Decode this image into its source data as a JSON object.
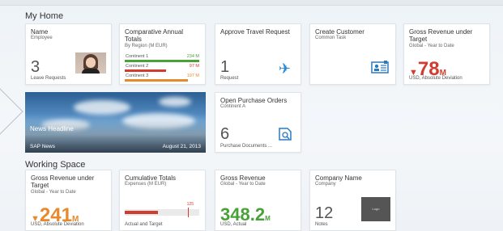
{
  "home": {
    "title": "My Home",
    "tiles": {
      "name": {
        "title": "Name",
        "subtitle": "Employee",
        "number": "3",
        "footer": "Leave Requests"
      },
      "comparative": {
        "title": "Comparative Annual Totals",
        "subtitle": "By Region (M EUR)",
        "rows": [
          {
            "label": "Continent 1",
            "value": "234 M",
            "color": "#4aa13a",
            "fill": 1.0
          },
          {
            "label": "Continent 2",
            "value": "97 M",
            "color": "#d23b2f",
            "fill": 0.55
          },
          {
            "label": "Continent 3",
            "value": "197 M",
            "color": "#e8892b",
            "fill": 0.85
          }
        ]
      },
      "travel": {
        "title": "Approve Travel Request",
        "number": "1",
        "footer": "Request",
        "icon": "airplane-icon"
      },
      "customer": {
        "title": "Create Customer",
        "subtitle": "Common Task",
        "icon": "customer-card-icon"
      },
      "gross": {
        "title": "Gross Revenue under Target",
        "subtitle": "Global - Year to Date",
        "value": "78",
        "unit": "M",
        "footer": "USD, Absolute Deviation"
      },
      "news": {
        "headline": "News Headline",
        "source": "SAP News",
        "date": "August 21, 2013"
      },
      "purchase": {
        "title": "Open Purchase Orders",
        "subtitle": "Continent A",
        "number": "6",
        "footer": "Purchase Documents ...",
        "icon": "purchase-document-icon"
      }
    }
  },
  "working": {
    "title": "Working Space",
    "tiles": {
      "gross2": {
        "title": "Gross Revenue under Target",
        "subtitle": "Global - Year to Date",
        "value": "241",
        "unit": "M",
        "footer": "USD, Absolute Deviation"
      },
      "cumulative": {
        "title": "Cumulative Totals",
        "subtitle": "Expenses (M EUR)",
        "target_label": "125",
        "footer": "Actual and Target",
        "actual_fraction": 0.45,
        "target_fraction": 0.85
      },
      "gross3": {
        "title": "Gross Revenue",
        "subtitle": "Global - Year to Date",
        "value": "348.2",
        "unit": "M",
        "footer": "USD, Actual"
      },
      "company": {
        "title": "Company Name",
        "subtitle": "Company",
        "number": "12",
        "footer": "Notes",
        "logo_text": "Logo"
      }
    }
  }
}
